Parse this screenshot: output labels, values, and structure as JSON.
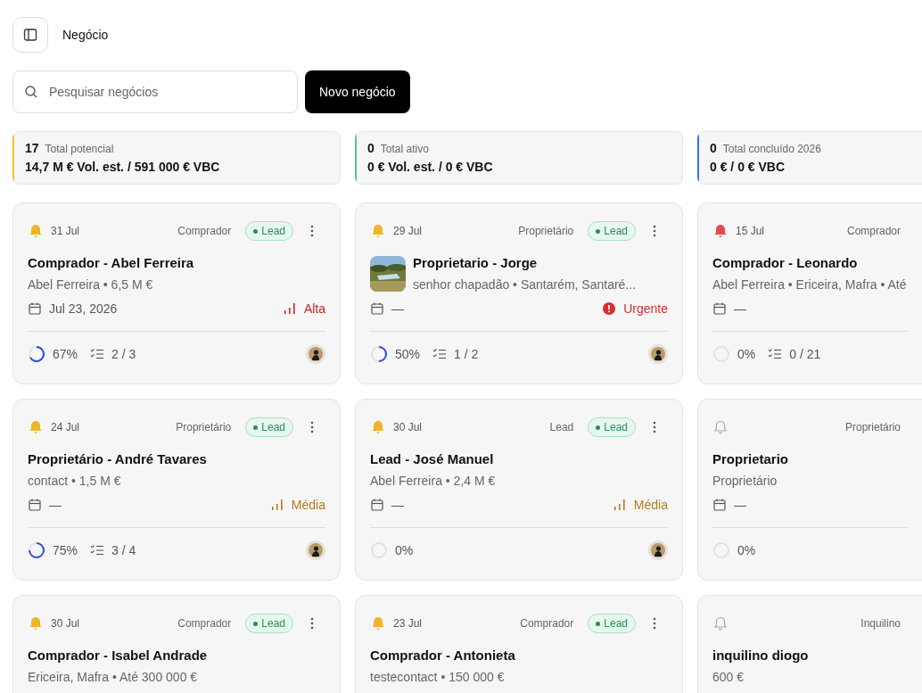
{
  "header": {
    "title": "Negócio"
  },
  "search": {
    "placeholder": "Pesquisar negócios"
  },
  "new_button": "Novo negócio",
  "summaries": [
    {
      "count": "17",
      "label": "Total potencial",
      "value": "14,7 M € Vol. est. / 591 000 € VBC",
      "color": "#f2c12e"
    },
    {
      "count": "0",
      "label": "Total ativo",
      "value": "0 € Vol. est. / 0 € VBC",
      "color": "#5cc08a"
    },
    {
      "count": "0",
      "label": "Total concluído 2026",
      "value": "0 € / 0 € VBC",
      "color": "#3b6ff5"
    }
  ],
  "deals": [
    {
      "bell": {
        "filled": true,
        "color": "#f0b429"
      },
      "date": "31 Jul",
      "type": "Comprador",
      "badge": "Lead",
      "menu": true,
      "title": "Comprador - Abel Ferreira",
      "subtitle": "Abel Ferreira • 6,5 M €",
      "due": "Jul 23, 2026",
      "priority": {
        "kind": "bars",
        "color": "#c62828",
        "label": "Alta"
      },
      "progress": {
        "level": 0.67,
        "text": "67%"
      },
      "tasks": "2 / 3",
      "avatar": true
    },
    {
      "bell": {
        "filled": true,
        "color": "#f0b429"
      },
      "date": "29 Jul",
      "type": "Proprietário",
      "badge": "Lead",
      "menu": true,
      "title": "Proprietario - Jorge",
      "subtitle": "senhor chapadão • Santarém, Santaré...",
      "due": "—",
      "priority": {
        "kind": "alert",
        "color": "#d32f2f",
        "label": "Urgente"
      },
      "progress": {
        "level": 0.5,
        "text": "50%"
      },
      "tasks": "1 / 2",
      "avatar": true
    },
    {
      "bell": {
        "filled": true,
        "color": "#e5484d"
      },
      "date": "15 Jul",
      "type": "Comprador",
      "title": "Comprador - Leonardo",
      "subtitle": "Abel Ferreira • Ericeira, Mafra • Até",
      "due": "—",
      "progress": {
        "text": "0%"
      },
      "tasks": "0 / 21"
    },
    {
      "bell": {
        "filled": true,
        "color": "#f0b429"
      },
      "date": "24 Jul",
      "type": "Proprietário",
      "badge": "Lead",
      "menu": true,
      "title": "Proprietário - André Tavares",
      "subtitle": "contact • 1,5 M €",
      "due": "—",
      "priority": {
        "kind": "bars",
        "color": "#b7791f",
        "label": "Média"
      },
      "progress": {
        "level": 0.75,
        "text": "75%"
      },
      "tasks": "3 / 4",
      "avatar": true
    },
    {
      "bell": {
        "filled": true,
        "color": "#f0b429"
      },
      "date": "30 Jul",
      "type": "Lead",
      "badge": "Lead",
      "menu": true,
      "title": "Lead - José Manuel",
      "subtitle": "Abel Ferreira • 2,4 M €",
      "due": "—",
      "priority": {
        "kind": "bars",
        "color": "#b7791f",
        "label": "Média"
      },
      "progress": {
        "text": "0%"
      },
      "avatar": true
    },
    {
      "bell": {
        "filled": false,
        "color": "#aaaaaa"
      },
      "type": "Proprietário",
      "title": "Proprietario",
      "subtitle": "Proprietário",
      "due": "—",
      "progress": {
        "text": "0%"
      }
    },
    {
      "bell": {
        "filled": true,
        "color": "#f0b429"
      },
      "date": "30 Jul",
      "type": "Comprador",
      "badge": "Lead",
      "menu": true,
      "title": "Comprador - Isabel Andrade",
      "subtitle": "Ericeira, Mafra • Até 300 000 €"
    },
    {
      "bell": {
        "filled": true,
        "color": "#f0b429"
      },
      "date": "23 Jul",
      "type": "Comprador",
      "badge": "Lead",
      "menu": true,
      "title": "Comprador - Antonieta",
      "subtitle": "testecontact • 150 000 €"
    },
    {
      "bell": {
        "filled": false,
        "color": "#aaaaaa"
      },
      "type": "Inquilino",
      "title": "inquilino diogo",
      "subtitle": "600 €"
    }
  ]
}
